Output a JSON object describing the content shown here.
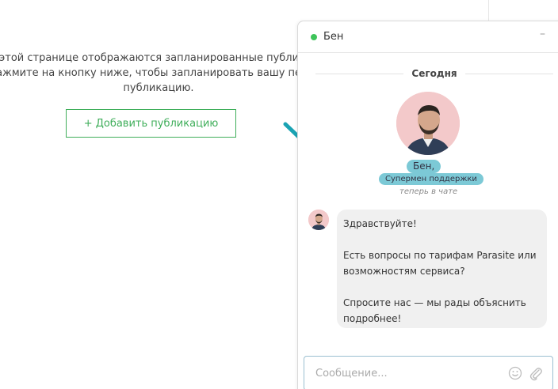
{
  "background": {
    "text_lines": [
      "На этой странице отображаются запланированные публикации.",
      "Нажмите на кнопку ниже, чтобы запланировать вашу первую",
      "публикацию."
    ],
    "add_button_label": "+ Добавить публикацию"
  },
  "chat": {
    "header": {
      "agent_name": "Бен",
      "minimize_symbol": "–",
      "online_color": "#3ec45a"
    },
    "date_separator": "Сегодня",
    "agent": {
      "first_name": "Бен,",
      "role": "Супермен поддержки",
      "status": "теперь в чате"
    },
    "message": {
      "lines": [
        "Здравствуйте!",
        "Есть вопросы по тарифам Parasite или возможностям сервиса?",
        "Спросите нас — мы рады объяснить подробнее!"
      ]
    },
    "input": {
      "placeholder": "Сообщение...",
      "value": ""
    },
    "icons": {
      "emoji": "smiley-icon",
      "attach": "paperclip-icon"
    }
  },
  "colors": {
    "accent_green": "#3fae5a",
    "badge_teal": "#7cc9d6",
    "arrow_teal": "#1aa3b3"
  }
}
